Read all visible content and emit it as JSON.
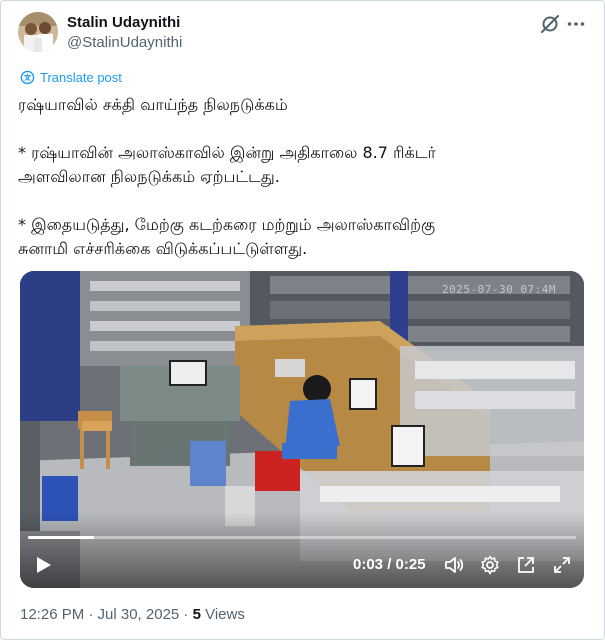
{
  "author": {
    "name": "Stalin Udaynithi",
    "handle": "@StalinUdaynithi"
  },
  "translate_label": "Translate post",
  "post_text": {
    "line1": "ரஷ்யாவில் சக்தி வாய்ந்த நிலநடுக்கம்",
    "para2_line1": "* ரஷ்யாவின் அலாஸ்காவில் இன்று அதிகாலை 8.7 ரிக்டர்",
    "para2_line2": "அளவிலான நிலநடுக்கம் ஏற்பட்டது.",
    "para3_line1": "* இதையடுத்து, மேற்கு கடற்கரை மற்றும் அலாஸ்காவிற்கு",
    "para3_line2": "சுனாமி எச்சரிக்கை விடுக்கப்பட்டுள்ளது."
  },
  "video": {
    "camera_stamp": "2025-07-30 07:4M",
    "time_display": "0:03 / 0:25",
    "progress": 0.12,
    "icons": [
      "play-icon",
      "volume-icon",
      "settings-gear-icon",
      "popout-icon",
      "fullscreen-icon"
    ]
  },
  "header_icons": [
    "grok-icon",
    "more-options-icon"
  ],
  "footer": {
    "timestamp": "12:26 PM · Jul 30, 2025 · ",
    "views_count": "5",
    "views_label": " Views"
  },
  "colors": {
    "accent": "#1d9bf0",
    "text": "#0f1419",
    "muted": "#536471",
    "border": "#cfd9de"
  }
}
